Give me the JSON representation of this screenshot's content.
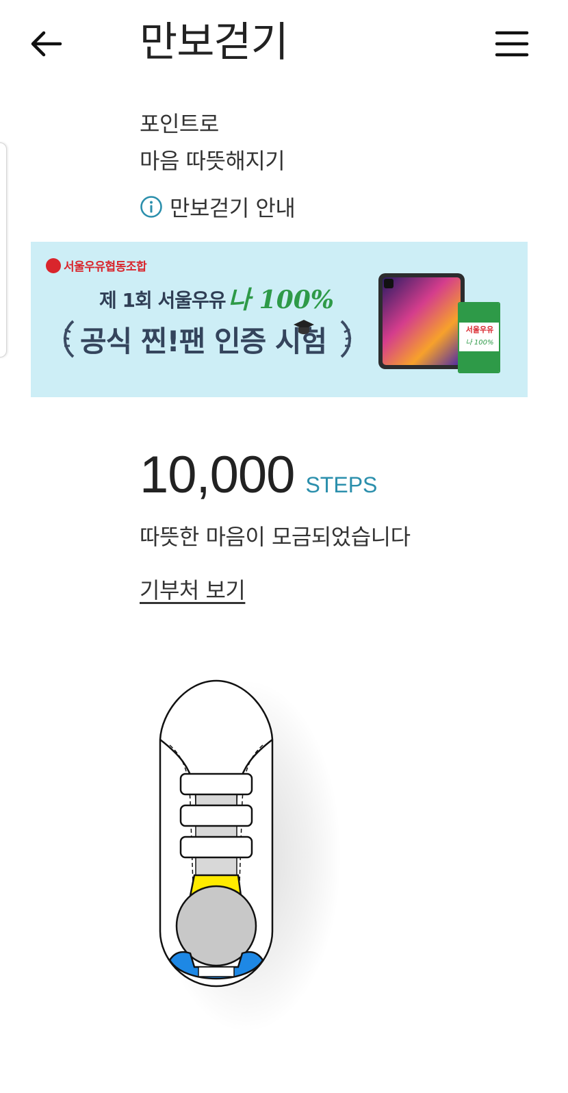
{
  "header": {
    "title": "만보걷기",
    "back_icon": "arrow-left-icon",
    "menu_icon": "hamburger-menu-icon"
  },
  "intro": {
    "line1": "포인트로",
    "line2": "마음 따뜻해지기",
    "guide_label": "만보걷기 안내",
    "guide_icon": "info-icon"
  },
  "banner": {
    "logo_text": "서울우유협동조합",
    "line1": "제 1회 서울우유",
    "line1_accent": "나 100%",
    "line2": "공식 찐!팬 인증 시험",
    "carton_brand": "서울우유",
    "carton_sub": "나 100%",
    "background_color": "#cdeef6"
  },
  "steps": {
    "value": "10,000",
    "unit": "STEPS",
    "unit_color": "#2b8fac"
  },
  "message": "따뜻한 마음이 모금되었습니다",
  "donation_link": "기부처 보기",
  "shoe": {
    "icon": "sneaker-illustration",
    "heel_color": "#1e88e5",
    "tongue_color": "#ffeb00"
  }
}
